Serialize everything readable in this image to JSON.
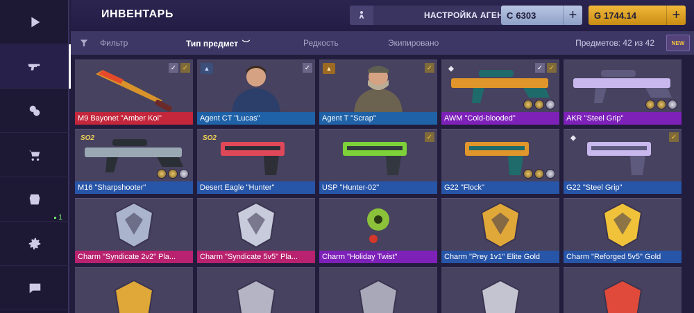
{
  "sidebar": {
    "items": [
      {
        "name": "play-icon"
      },
      {
        "name": "gun-icon"
      },
      {
        "name": "coins-icon"
      },
      {
        "name": "cart-icon"
      },
      {
        "name": "case-icon"
      },
      {
        "name": "gear-icon"
      },
      {
        "name": "chat-icon"
      }
    ],
    "badge": "1"
  },
  "header": {
    "title": "ИНВЕНТАРЬ",
    "agent_button": "НАСТРОЙКА АГЕНТА",
    "silver_symbol": "C",
    "silver_amount": "6303",
    "gold_symbol": "G",
    "gold_amount": "1744.14",
    "plus": "+"
  },
  "filters": {
    "filter_label": "Фильтр",
    "type_label": "Тип предмет",
    "rarity_label": "Редкость",
    "equipped_label": "Экипировано",
    "count_label": "Предметов: 42 из 42",
    "new_badge": "NEW"
  },
  "colors": {
    "covert": "#c4263c",
    "classified": "#7d21b9",
    "restricted": "#2f78c2",
    "mil_spec": "#2755a8",
    "industrial": "#1f62a8",
    "charm_pink": "#b8226e",
    "accent_gold": "#f0b93a",
    "silver_currency": "#a9b6d8"
  },
  "grid": {
    "rows": [
      [
        {
          "name": "M9 Bayonet \"Amber Koi\"",
          "rarity": "#c4263c",
          "checks": [
            "✓",
            "✓"
          ]
        },
        {
          "name": "Agent CT \"Lucas\"",
          "rarity": "#1f62a8",
          "checks": [
            "✓"
          ],
          "tag": "CT"
        },
        {
          "name": "Agent T \"Scrap\"",
          "rarity": "#1f62a8",
          "checks": [
            "✓"
          ],
          "tag": "T"
        },
        {
          "name": "AWM \"Cold-blooded\"",
          "rarity": "#7d21b9",
          "checks": [
            "✓",
            "✓"
          ],
          "tag": "ST"
        },
        {
          "name": "AKR \"Steel Grip\"",
          "rarity": "#7d21b9",
          "checks": []
        }
      ],
      [
        {
          "name": "M16 \"Sharpshooter\"",
          "rarity": "#2755a8",
          "checks": [],
          "tag": "SO2"
        },
        {
          "name": "Desert Eagle \"Hunter\"",
          "rarity": "#2755a8",
          "checks": [],
          "tag": "SO2"
        },
        {
          "name": "USP \"Hunter-02\"",
          "rarity": "#2755a8",
          "checks": [
            "✓"
          ]
        },
        {
          "name": "G22 \"Flock\"",
          "rarity": "#2755a8",
          "checks": []
        },
        {
          "name": "G22 \"Steel Grip\"",
          "rarity": "#2755a8",
          "checks": [
            "✓"
          ],
          "tag": "ST"
        }
      ],
      [
        {
          "name": "Charm \"Syndicate 2v2\" Pla...",
          "rarity": "#b8226e",
          "checks": []
        },
        {
          "name": "Charm \"Syndicate 5v5\" Pla...",
          "rarity": "#b8226e",
          "checks": []
        },
        {
          "name": "Charm \"Holiday Twist\"",
          "rarity": "#7d21b9",
          "checks": []
        },
        {
          "name": "Charm \"Prey 1v1\" Elite Gold",
          "rarity": "#2755a8",
          "checks": []
        },
        {
          "name": "Charm \"Reforged 5v5\" Gold",
          "rarity": "#2755a8",
          "checks": []
        }
      ],
      [
        {
          "name": "",
          "rarity": "#47425f",
          "checks": []
        },
        {
          "name": "",
          "rarity": "#47425f",
          "checks": []
        },
        {
          "name": "",
          "rarity": "#47425f",
          "checks": []
        },
        {
          "name": "",
          "rarity": "#47425f",
          "checks": []
        },
        {
          "name": "",
          "rarity": "#47425f",
          "checks": []
        }
      ]
    ]
  }
}
